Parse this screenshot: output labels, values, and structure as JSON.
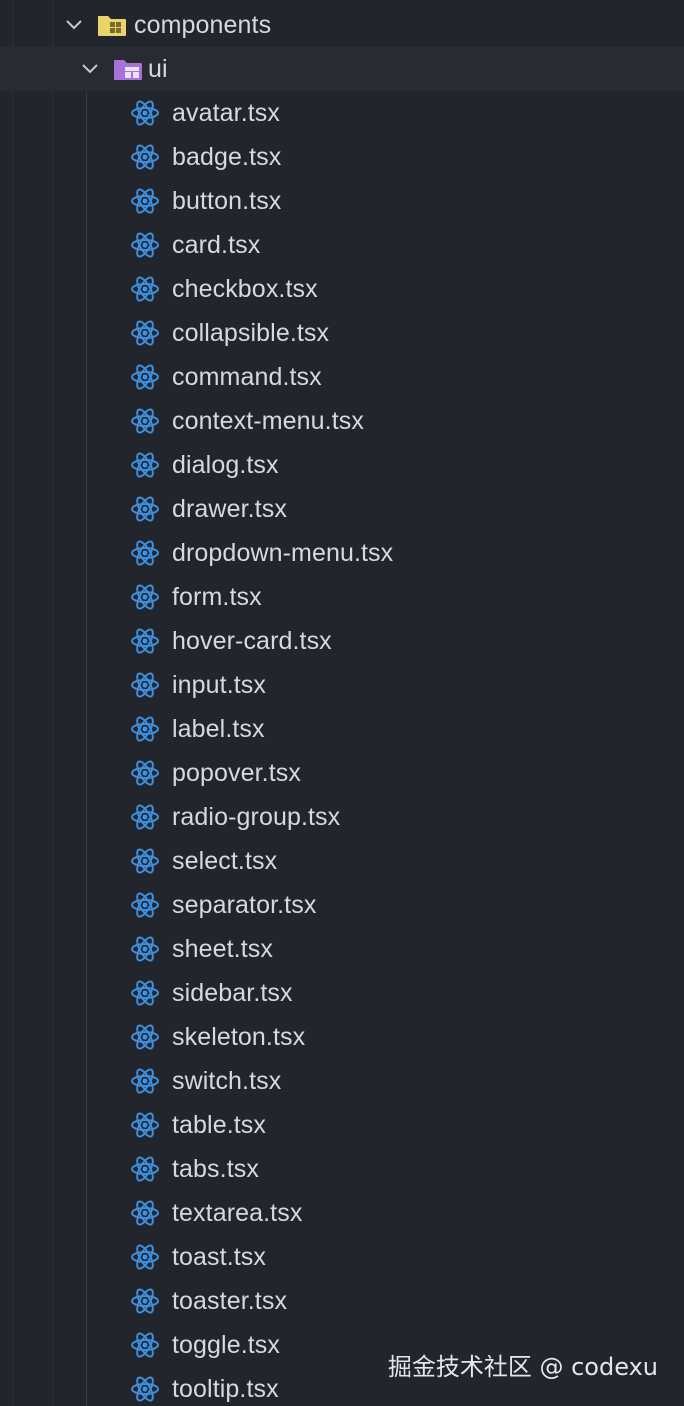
{
  "tree": {
    "root_folder": {
      "name": "components",
      "expanded": true,
      "icon": "folder-components-icon"
    },
    "sub_folder": {
      "name": "ui",
      "expanded": true,
      "icon": "folder-ui-icon"
    },
    "files": [
      {
        "name": "avatar.tsx",
        "icon": "react-icon"
      },
      {
        "name": "badge.tsx",
        "icon": "react-icon"
      },
      {
        "name": "button.tsx",
        "icon": "react-icon"
      },
      {
        "name": "card.tsx",
        "icon": "react-icon"
      },
      {
        "name": "checkbox.tsx",
        "icon": "react-icon"
      },
      {
        "name": "collapsible.tsx",
        "icon": "react-icon"
      },
      {
        "name": "command.tsx",
        "icon": "react-icon"
      },
      {
        "name": "context-menu.tsx",
        "icon": "react-icon"
      },
      {
        "name": "dialog.tsx",
        "icon": "react-icon"
      },
      {
        "name": "drawer.tsx",
        "icon": "react-icon"
      },
      {
        "name": "dropdown-menu.tsx",
        "icon": "react-icon"
      },
      {
        "name": "form.tsx",
        "icon": "react-icon"
      },
      {
        "name": "hover-card.tsx",
        "icon": "react-icon"
      },
      {
        "name": "input.tsx",
        "icon": "react-icon"
      },
      {
        "name": "label.tsx",
        "icon": "react-icon"
      },
      {
        "name": "popover.tsx",
        "icon": "react-icon"
      },
      {
        "name": "radio-group.tsx",
        "icon": "react-icon"
      },
      {
        "name": "select.tsx",
        "icon": "react-icon"
      },
      {
        "name": "separator.tsx",
        "icon": "react-icon"
      },
      {
        "name": "sheet.tsx",
        "icon": "react-icon"
      },
      {
        "name": "sidebar.tsx",
        "icon": "react-icon"
      },
      {
        "name": "skeleton.tsx",
        "icon": "react-icon"
      },
      {
        "name": "switch.tsx",
        "icon": "react-icon"
      },
      {
        "name": "table.tsx",
        "icon": "react-icon"
      },
      {
        "name": "tabs.tsx",
        "icon": "react-icon"
      },
      {
        "name": "textarea.tsx",
        "icon": "react-icon"
      },
      {
        "name": "toast.tsx",
        "icon": "react-icon"
      },
      {
        "name": "toaster.tsx",
        "icon": "react-icon"
      },
      {
        "name": "toggle.tsx",
        "icon": "react-icon"
      },
      {
        "name": "tooltip.tsx",
        "icon": "react-icon"
      }
    ]
  },
  "watermark": "掘金技术社区 @ codexu",
  "colors": {
    "background": "#22252b",
    "text": "#d6d9de",
    "react_blue": "#3d8fe0",
    "folder_components": "#e9d36b",
    "folder_ui": "#a872d8",
    "guide": "#3a3e46"
  }
}
